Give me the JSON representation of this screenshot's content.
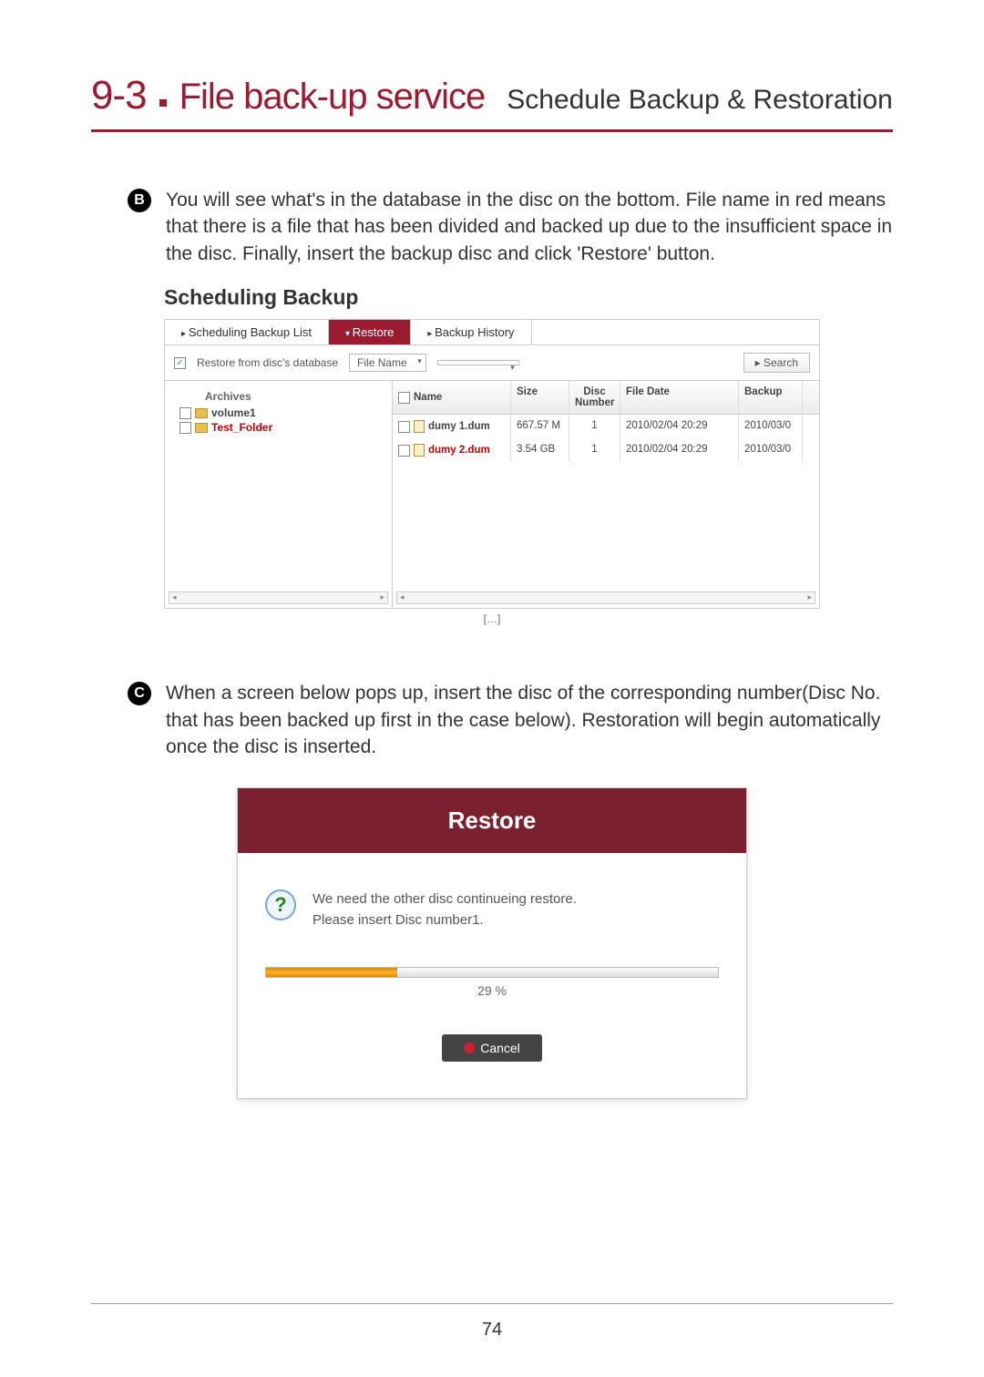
{
  "section": {
    "number": "9-3",
    "title_main": "File back-up service",
    "title_sub": "Schedule Backup & Restoration"
  },
  "bullet_b": {
    "letter": "B",
    "text": "You will see what's in the database in the disc on the bottom. File name in red means that there is a file that has been divided and backed up due to the insufficient space in the disc. Finally, insert the backup disc and click 'Restore' button."
  },
  "app1": {
    "title": "Scheduling Backup",
    "tabs": {
      "list": "Scheduling Backup List",
      "restore": "Restore",
      "history": "Backup History"
    },
    "filter": {
      "checkbox_label": "Restore from disc's database",
      "select_label": "File Name",
      "search": "Search"
    },
    "tree": {
      "header": "Archives",
      "items": [
        "volume1",
        "Test_Folder"
      ]
    },
    "table": {
      "headers": {
        "name": "Name",
        "size": "Size",
        "disc": "Disc Number",
        "date": "File Date",
        "backup": "Backup"
      },
      "rows": [
        {
          "name": "dumy 1.dum",
          "size": "667.57 M",
          "disc": "1",
          "date": "2010/02/04 20:29",
          "backup": "2010/03/0",
          "red": false
        },
        {
          "name": "dumy 2.dum",
          "size": "3.54 GB",
          "disc": "1",
          "date": "2010/02/04 20:29",
          "backup": "2010/03/0",
          "red": true
        }
      ],
      "pager": "[…]"
    }
  },
  "bullet_c": {
    "letter": "C",
    "text": "When a screen below pops up, insert the disc of the corresponding number(Disc No. that has been backed up first in the case below). Restoration will begin automatically once the disc is inserted."
  },
  "dialog": {
    "title": "Restore",
    "msg1": "We need the other disc continueing restore.",
    "msg2": "Please insert Disc number1.",
    "progress_pct": "29 %",
    "cancel": "Cancel"
  },
  "page_number": "74"
}
